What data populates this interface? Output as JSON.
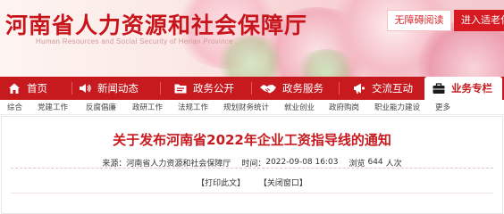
{
  "header": {
    "site_title": "河南省人力资源和社会保障厅",
    "site_subtitle": "Human Resources and Social Security of Henan Province",
    "accessibility_label": "无障碍阅读",
    "elder_mode_label": "进入适老化"
  },
  "mainnav": {
    "items": [
      {
        "label": "首页",
        "icon": "home-icon"
      },
      {
        "label": "新闻动态",
        "icon": "speaker-icon"
      },
      {
        "label": "政务公开",
        "icon": "folder-icon"
      },
      {
        "label": "政务服务",
        "icon": "handshake-icon"
      },
      {
        "label": "交流互动",
        "icon": "megaphone-icon"
      },
      {
        "label": "业务专栏",
        "icon": "briefcase-icon"
      }
    ],
    "active_index": 5,
    "bg_color": "#c71a1f"
  },
  "subnav": {
    "items": [
      "综合",
      "党建工作",
      "反腐倡廉",
      "政研工作",
      "法规工作",
      "规划财务统计",
      "就业创业",
      "政府购岗",
      "职业能力建设",
      "更多"
    ]
  },
  "article": {
    "title": "关于发布河南省2022年企业工资指导线的通知",
    "source_label": "来源：",
    "source": "河南省人力资源和社会保障厅",
    "time_label": "时间：",
    "time": "2022-09-08 16:03",
    "views_label": "浏览",
    "views": "644",
    "views_unit": "人次",
    "print_label": "【打印此文】",
    "close_label": "【关闭窗口】"
  },
  "colors": {
    "brand_red": "#c71a1f",
    "title_red": "#c8141b"
  }
}
